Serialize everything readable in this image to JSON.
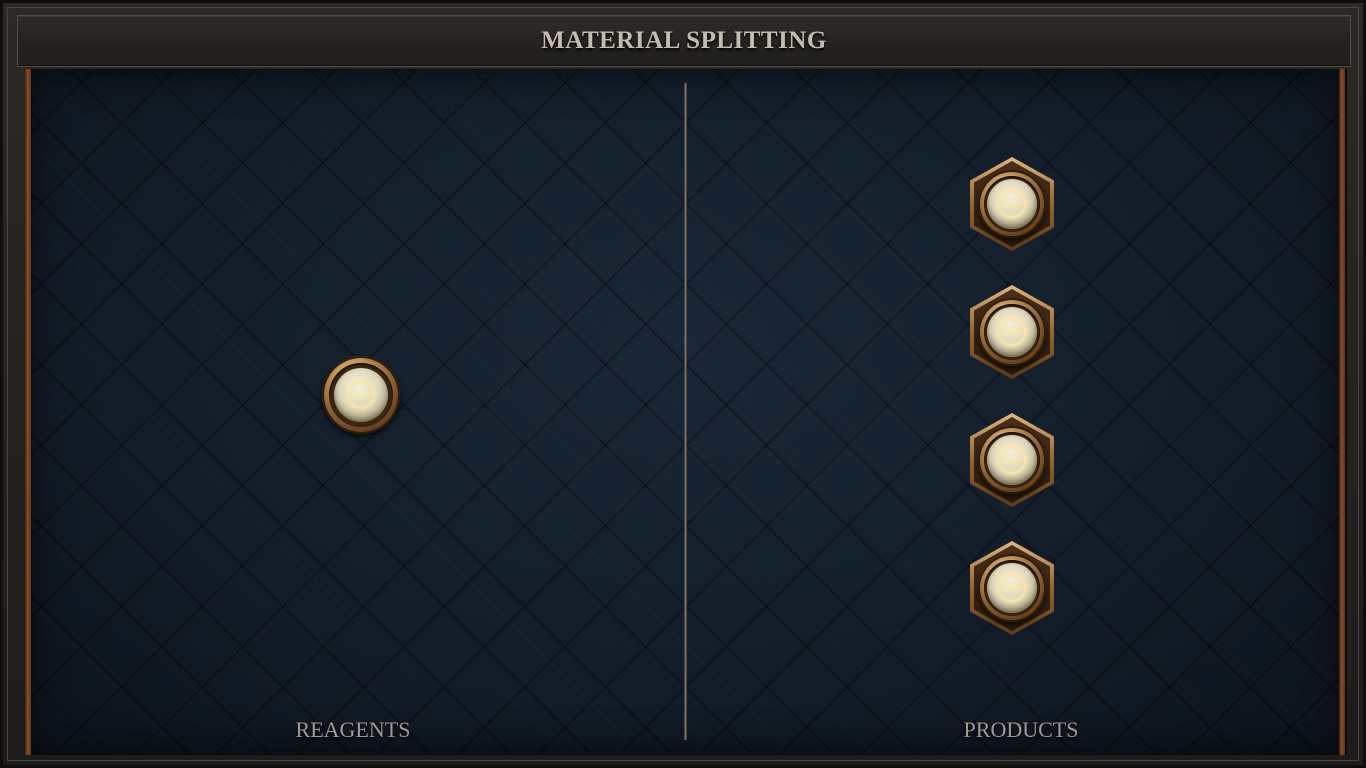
{
  "header": {
    "title": "MATERIAL SPLITTING"
  },
  "panels": {
    "reagents": {
      "label": "REAGENTS",
      "slots": [
        {
          "icon": "theta-rune-icon",
          "shape": "round"
        }
      ]
    },
    "products": {
      "label": "PRODUCTS",
      "slots": [
        {
          "icon": "theta-rune-icon",
          "shape": "hexagon"
        },
        {
          "icon": "theta-rune-icon",
          "shape": "hexagon"
        },
        {
          "icon": "theta-rune-icon",
          "shape": "hexagon"
        },
        {
          "icon": "theta-rune-icon",
          "shape": "hexagon"
        }
      ]
    }
  },
  "colors": {
    "board_background": "#121c28",
    "frame": "#2b2925",
    "title_text": "#c5bcb0",
    "label_text": "#a19a92",
    "brass": "#b0824a",
    "copper_edge": "#8a4e26",
    "orb": "#ddd7bb",
    "rune_glow": "#f6e7a8"
  }
}
